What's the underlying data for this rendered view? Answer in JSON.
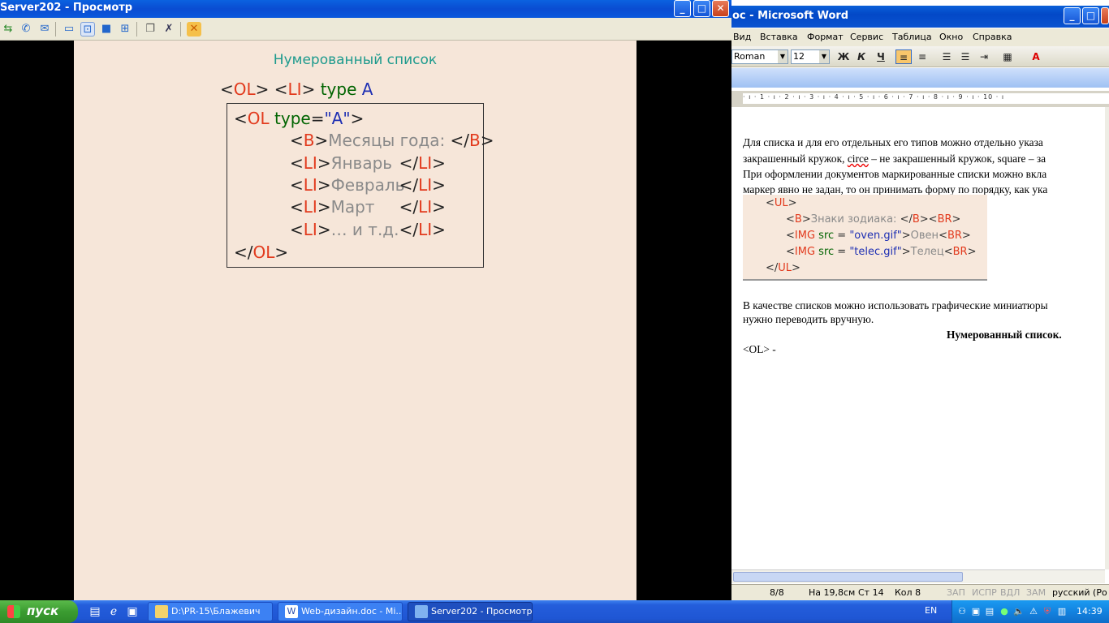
{
  "word": {
    "title": "oc - Microsoft Word",
    "menu": [
      "Вид",
      "Вставка",
      "Формат",
      "Сервис",
      "Таблица",
      "Окно",
      "Справка"
    ],
    "font_name": "Roman",
    "font_size": "12",
    "bold_label": "Ж",
    "italic_label": "К",
    "underline_label": "Ч",
    "ruler_text": "· ı · 1 · ı · 2 · ı · 3 · ı · 4 · ı · 5 · ı · 6 · ı · 7 · ı · 8 · ı · 9 · ı · 10 · ı",
    "doc_lines": [
      " Для списка и для его отдельных его типов можно отдельно указа",
      "закрашенный кружок, ",
      "circe",
      " – не закрашенный кружок, square – за",
      "При оформлении документов маркированные списки можно вкла",
      "маркер явно не задан, то он принимать форму по порядку, как ука"
    ],
    "code": {
      "ul_open": "UL",
      "b": "B",
      "zodiac": "Знаки зодиака: ",
      "br": "BR",
      "img": "IMG",
      "src": "src",
      "oven_file": "\"oven.gif\"",
      "oven": "Овен",
      "telec_file": "\"telec.gif\"",
      "telec": "Телец",
      "ul_close": "UL"
    },
    "para2_line1": "В качестве списков можно использовать графические миниатюры",
    "para2_line2": "нужно переводить вручную.",
    "heading": "Нумерованный список.",
    "ol_line": "<OL> -",
    "status": {
      "page": "8/8",
      "at": "На 19,8см",
      "line": "Ст 14",
      "col": "Кол 8",
      "rec": "ЗАП",
      "trk": "ИСПР",
      "ext": "ВДЛ",
      "ovr": "ЗАМ",
      "lang": "русский (Ро"
    }
  },
  "viewer": {
    "title": "Server202 - Просмотр",
    "slide": {
      "title": "Нумерованный список",
      "sub_ol": "OL",
      "sub_li": "LI",
      "sub_type": "type",
      "sub_a": "A",
      "ol": "OL",
      "type_kw": "type",
      "type_val": "\"A\"",
      "b": "B",
      "months_label": "Месяцы года: ",
      "li": "LI",
      "items": [
        "Январь",
        "Февраль",
        "Март",
        "… и т.д."
      ]
    }
  },
  "taskbar": {
    "start": "пуск",
    "tasks": [
      "D:\\PR-15\\Блажевич",
      "Web-дизайн.doc - Mi...",
      "Server202 - Просмотр"
    ],
    "lang": "EN",
    "clock": "14:39"
  },
  "colors": {
    "slide_bg": "#f6e6d9",
    "slide_title": "#1d9a8d",
    "tag_red": "#e23a1d",
    "attr_green": "#006400",
    "value_blue": "#1e2fb3",
    "text_gray": "#8a8a8a"
  }
}
